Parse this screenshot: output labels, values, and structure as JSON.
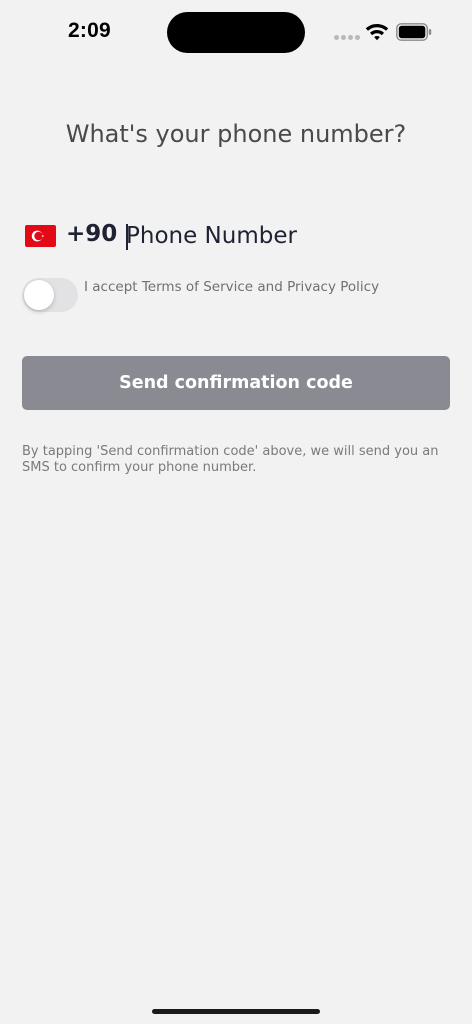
{
  "status_bar": {
    "time": "2:09",
    "icons": [
      "cellular-signal-icon",
      "wifi-icon",
      "battery-icon"
    ]
  },
  "title": "What's your phone number?",
  "phone": {
    "country_flag": "turkey-flag-icon",
    "country_code": "+90",
    "value": "",
    "placeholder": "Phone Number"
  },
  "terms": {
    "toggle_on": false,
    "label": "I accept Terms of Service and Privacy Policy"
  },
  "send_button": {
    "label": "Send confirmation code",
    "color": "#898a92"
  },
  "sms_info": "By tapping 'Send confirmation code' above, we will send you an SMS to confirm your phone number.",
  "colors": {
    "background": "#f2f2f2",
    "text_dark": "#1e2233",
    "text_muted": "#7a7a7a"
  }
}
